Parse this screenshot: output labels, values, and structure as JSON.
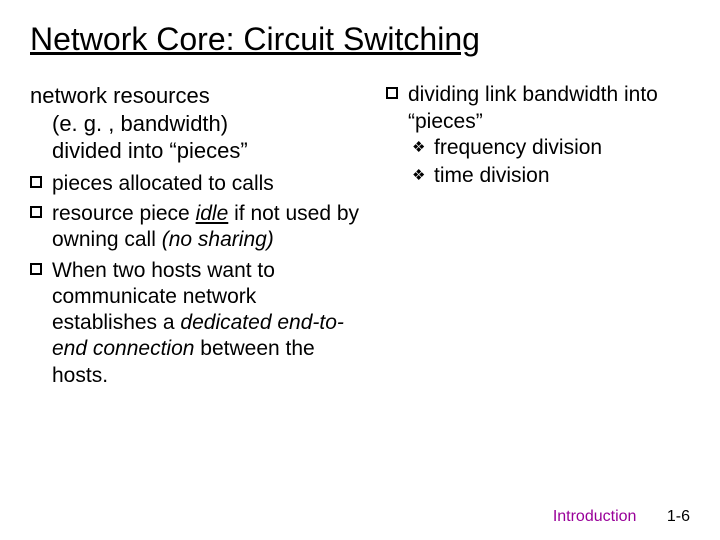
{
  "title": "Network Core: Circuit Switching",
  "left": {
    "lead_line1": "network resources",
    "lead_line2": "(e. g. , bandwidth)",
    "lead_line3": "divided into “pieces”",
    "bullets": [
      {
        "pre": "pieces allocated to calls"
      },
      {
        "pre": "resource piece ",
        "italic_underline": "idle",
        "mid": " if not used by owning call ",
        "italic_tail": "(no sharing)"
      },
      {
        "pre": "When two hosts want to communicate network establishes a ",
        "italic_mid": "dedicated end-to-end connection",
        "post": " between the hosts."
      }
    ]
  },
  "right": {
    "bullet_text": "dividing link bandwidth into “pieces”",
    "sub": [
      "frequency division",
      "time division"
    ]
  },
  "footer": {
    "section": "Introduction",
    "page": "1-6"
  }
}
